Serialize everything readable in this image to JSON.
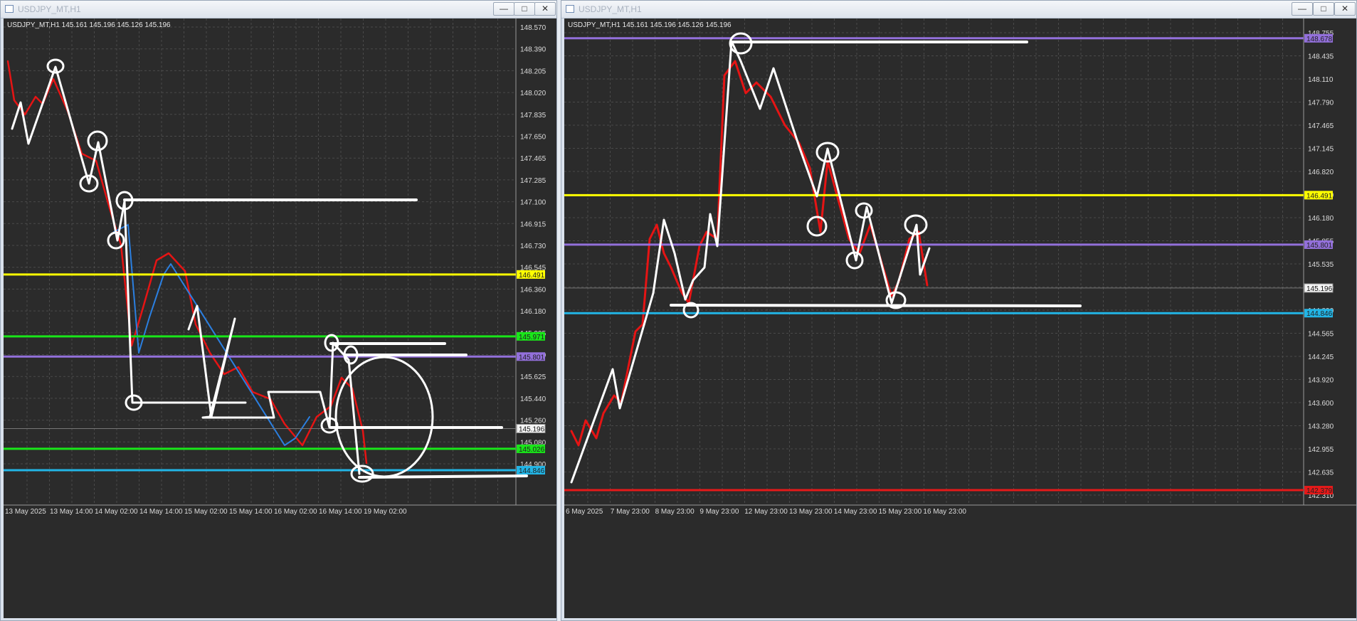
{
  "windows": [
    {
      "title": "USDJPY_MT,H1",
      "header": "USDJPY_MT,H1  145.161 145.196 145.126 145.196",
      "buttons": {
        "minimize": "—",
        "maximize": "□",
        "close": "✕"
      },
      "chart_data": {
        "type": "line",
        "title": "USDJPY_MT,H1",
        "yticks": [
          "148.570",
          "148.390",
          "148.205",
          "148.020",
          "147.835",
          "147.650",
          "147.465",
          "147.285",
          "147.100",
          "146.915",
          "146.730",
          "146.545",
          "146.360",
          "146.180",
          "145.995",
          "145.810",
          "145.625",
          "145.440",
          "145.260",
          "145.080",
          "144.900"
        ],
        "xticks": [
          "13 May 2025",
          "13 May 14:00",
          "14 May 02:00",
          "14 May 14:00",
          "15 May 02:00",
          "15 May 14:00",
          "16 May 02:00",
          "16 May 14:00",
          "19 May 02:00"
        ],
        "hlines": [
          {
            "price": 146.491,
            "label": "146.491",
            "color": "#ffff00"
          },
          {
            "price": 145.971,
            "label": "145.971",
            "color": "#19e619"
          },
          {
            "price": 145.801,
            "label": "145.801",
            "color": "#9370db"
          },
          {
            "price": 145.026,
            "label": "145.026",
            "color": "#19e619"
          },
          {
            "price": 144.846,
            "label": "144.846",
            "color": "#22b5e6"
          }
        ],
        "current_price": "145.196"
      }
    },
    {
      "title": "USDJPY_MT,H1",
      "header": "USDJPY_MT,H1  145.161 145.196 145.126 145.196",
      "buttons": {
        "minimize": "—",
        "maximize": "□",
        "close": "✕"
      },
      "chart_data": {
        "type": "line",
        "title": "USDJPY_MT,H1",
        "yticks": [
          "148.755",
          "148.435",
          "148.110",
          "147.790",
          "147.465",
          "147.145",
          "146.820",
          "146.500",
          "146.180",
          "145.855",
          "145.535",
          "145.210",
          "144.890",
          "144.565",
          "144.245",
          "143.920",
          "143.600",
          "143.280",
          "142.955",
          "142.635",
          "142.310"
        ],
        "xticks": [
          "6 May 2025",
          "7 May 23:00",
          "8 May 23:00",
          "9 May 23:00",
          "12 May 23:00",
          "13 May 23:00",
          "14 May 23:00",
          "15 May 23:00",
          "16 May 23:00"
        ],
        "hlines": [
          {
            "price": 148.678,
            "label": "148.678",
            "color": "#9370db"
          },
          {
            "price": 146.491,
            "label": "146.491",
            "color": "#ffff00"
          },
          {
            "price": 145.801,
            "label": "145.801",
            "color": "#9370db"
          },
          {
            "price": 144.846,
            "label": "144.846",
            "color": "#22b5e6"
          },
          {
            "price": 142.379,
            "label": "142.379",
            "color": "#e61919"
          }
        ],
        "current_price": "145.196"
      }
    }
  ]
}
